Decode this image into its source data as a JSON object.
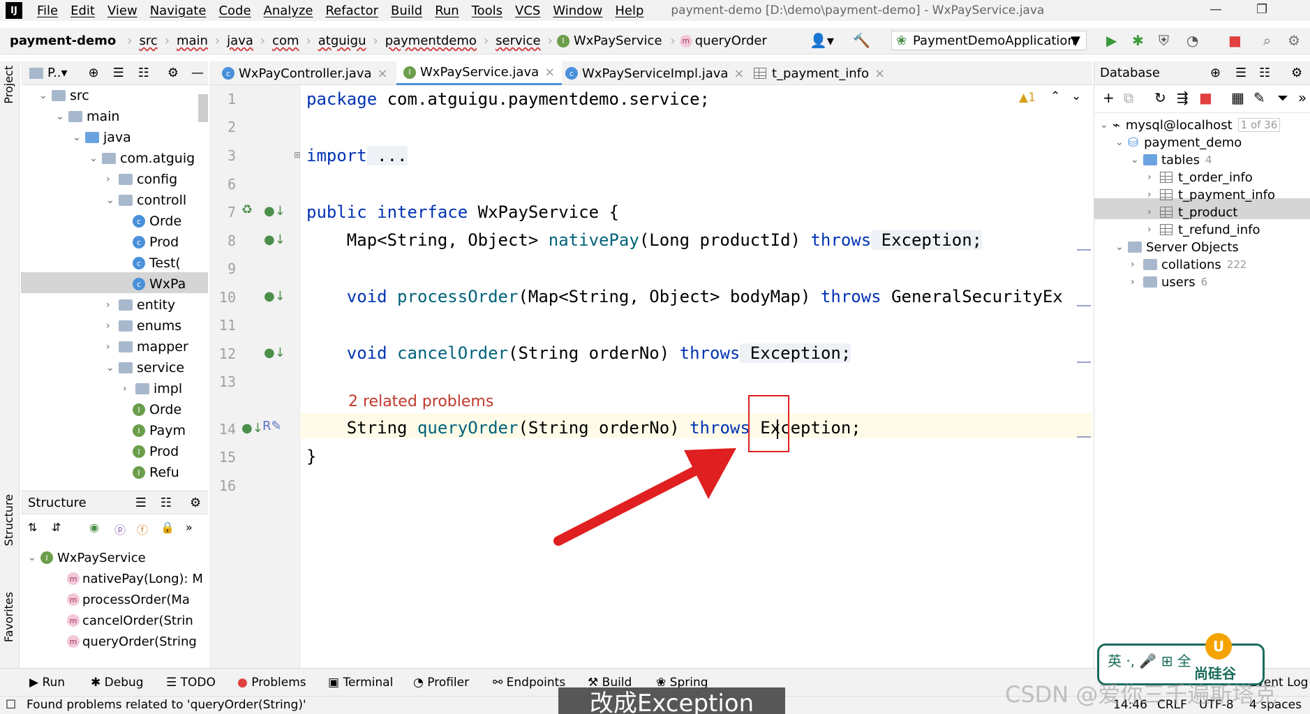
{
  "menubar": {
    "logo": "IJ",
    "items": [
      "File",
      "Edit",
      "View",
      "Navigate",
      "Code",
      "Analyze",
      "Refactor",
      "Build",
      "Run",
      "Tools",
      "VCS",
      "Window",
      "Help"
    ],
    "title": "payment-demo [D:\\demo\\payment-demo] - WxPayService.java"
  },
  "navbar": {
    "project": "payment-demo",
    "crumbs": [
      "src",
      "main",
      "java",
      "com",
      "atguigu",
      "paymentdemo",
      "service",
      "WxPayService",
      "queryOrder"
    ],
    "run_config": "PaymentDemoApplication"
  },
  "project_panel": {
    "title": "P..▾",
    "tree": [
      "src",
      "main",
      "java",
      "com.atguig",
      "config",
      "controll",
      "Orde",
      "Prod",
      "Test(",
      "WxPa",
      "entity",
      "enums",
      "mapper",
      "service",
      "impl",
      "Orde",
      "Paym",
      "Prod",
      "Refu"
    ]
  },
  "structure": {
    "title": "Structure",
    "root": "WxPayService",
    "methods": [
      "nativePay(Long): M",
      "processOrder(Ma",
      "cancelOrder(Strin",
      "queryOrder(String"
    ]
  },
  "left_tabs": {
    "project": "Project",
    "structure": "Structure",
    "favorites": "Favorites"
  },
  "editor_tabs": [
    "WxPayController.java",
    "WxPayService.java",
    "WxPayServiceImpl.java",
    "t_payment_info"
  ],
  "editor": {
    "line_numbers": [
      "1",
      "2",
      "3",
      "6",
      "7",
      "8",
      "9",
      "10",
      "11",
      "12",
      "13",
      "14",
      "15",
      "16"
    ],
    "warnings": "▲1",
    "problem_hint": "2 related problems",
    "lines": {
      "l1_kw": "package",
      "l1_rest": " com.atguigu.paymentdemo.service;",
      "l3_kw": "import",
      "l3_rest": " ...",
      "l7_kw1": "public",
      "l7_kw2": "interface",
      "l7_rest": " WxPayService {",
      "l8_a": "    Map<String, Object> ",
      "l8_fn": "nativePay",
      "l8_b": "(Long productId) ",
      "l8_kw": "throws",
      "l8_c": " Exception;",
      "l10_kw1": "    void ",
      "l10_fn": "processOrder",
      "l10_b": "(Map<String, Object> bodyMap) ",
      "l10_kw": "throws",
      "l10_c": " GeneralSecurityEx",
      "l12_kw1": "    void ",
      "l12_fn": "cancelOrder",
      "l12_b": "(String orderNo) ",
      "l12_kw": "throws",
      "l12_c": " Exception;",
      "l14_a": "    String ",
      "l14_fn": "queryOrder",
      "l14_b": "(String orderNo) ",
      "l14_kw": "throws",
      "l14_c": " Exception;",
      "l15": "}"
    }
  },
  "database": {
    "title": "Database",
    "nodes": {
      "host": "mysql@localhost",
      "host_count": "1 of 36",
      "db": "payment_demo",
      "tables": "tables",
      "tables_count": "4",
      "t1": "t_order_info",
      "t2": "t_payment_info",
      "t3": "t_product",
      "t4": "t_refund_info",
      "server": "Server Objects",
      "collations": "collations",
      "collations_count": "222",
      "users": "users",
      "users_count": "6"
    }
  },
  "bottom_tabs": [
    "Run",
    "Debug",
    "TODO",
    "Problems",
    "Terminal",
    "Profiler",
    "Endpoints",
    "Build",
    "Spring",
    "Event Log"
  ],
  "status": {
    "message": "Found problems related to 'queryOrder(String)'",
    "position": "14:46",
    "line_sep": "CRLF",
    "encoding": "UTF-8",
    "indent": "4 spaces"
  },
  "overlay": {
    "subtitle": "改成Exception",
    "watermark": "CSDN @爱你三千遍斯塔克",
    "ime_text": "英 ·, 🎤 ⊞ 全",
    "brand": "尚硅谷"
  },
  "colors": {
    "keyword": "#0033b3",
    "method": "#00627a",
    "problem": "#c0392b",
    "annotation_box": "#e02020",
    "arrow": "#e02020"
  }
}
